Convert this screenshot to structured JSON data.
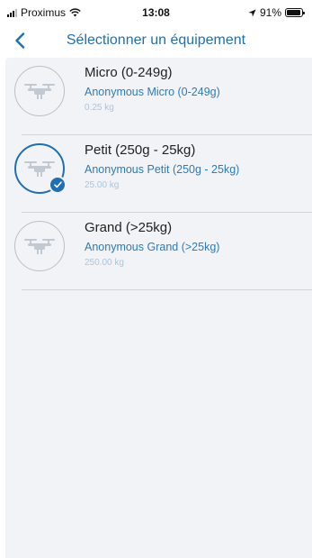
{
  "status_bar": {
    "carrier": "Proximus",
    "time": "13:08",
    "battery": "91%"
  },
  "header": {
    "title": "Sélectionner un équipement"
  },
  "equipment": [
    {
      "name": "Micro (0-249g)",
      "subtitle": "Anonymous  Micro (0-249g)",
      "weight": "0.25 kg",
      "selected": false
    },
    {
      "name": "Petit (250g - 25kg)",
      "subtitle": "Anonymous  Petit (250g - 25kg)",
      "weight": "25.00 kg",
      "selected": true
    },
    {
      "name": "Grand (>25kg)",
      "subtitle": "Anonymous  Grand (>25kg)",
      "weight": "250.00 kg",
      "selected": false
    }
  ],
  "colors": {
    "accent": "#1f6fb2",
    "subtitle": "#2e7bb8",
    "weight": "#a8c5df",
    "list_background": "#f2f3f6"
  },
  "icons": {
    "back": "chevron-left-icon",
    "item": "drone-icon",
    "selected": "checkmark-icon"
  }
}
